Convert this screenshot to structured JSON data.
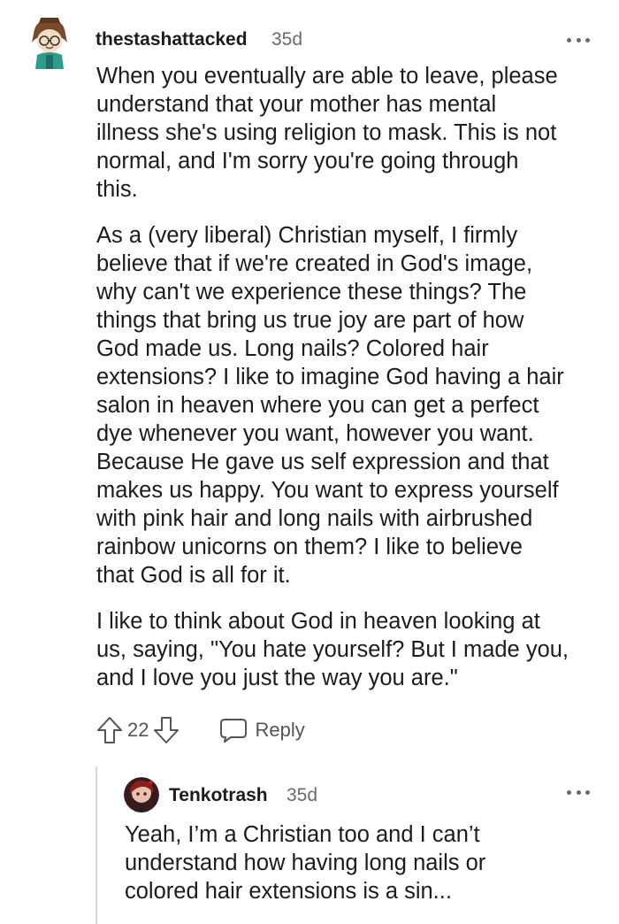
{
  "comment": {
    "username": "thestashattacked",
    "timestamp": "35d",
    "avatar_icon": "avatar-icon",
    "more_icon": "more-options-icon",
    "paragraphs": [
      "When you eventually are able to leave, please\nunderstand that your mother has mental\nillness she's using religion to mask. This is not\nnormal, and I'm sorry you're going through\nthis.",
      "As a (very liberal) Christian myself, I firmly\nbelieve that if we're created in God's image,\nwhy can't we experience these things? The\nthings that bring us true joy are part of how\nGod made us. Long nails? Colored hair\nextensions? I like to imagine God having a hair\nsalon in heaven where you can get a perfect\ndye whenever you want, however you want.\nBecause He gave us self expression and that\nmakes us happy. You want to express yourself\nwith pink hair and long nails with airbrushed\nrainbow unicorns on them? I like to believe\nthat God is all for it.",
      "I like to think about God in heaven looking at\nus, saying, \"You hate yourself? But I made you,\nand I love you just the way you are.\""
    ],
    "vote_count": "22",
    "reply_label": "Reply",
    "upvote_icon": "upvote-arrow-icon",
    "downvote_icon": "downvote-arrow-icon",
    "reply_icon": "chat-bubble-icon"
  },
  "reply": {
    "username": "Tenkotrash",
    "timestamp": "35d",
    "avatar_icon": "avatar-icon",
    "more_icon": "more-options-icon",
    "text": "Yeah, I’m a Christian too and I can’t\nunderstand how having long nails or\ncolored hair extensions is a sin..."
  },
  "colors": {
    "text": "#1c1c1c",
    "meta": "#6a6a6a",
    "thread_line": "#d8d8d8"
  }
}
